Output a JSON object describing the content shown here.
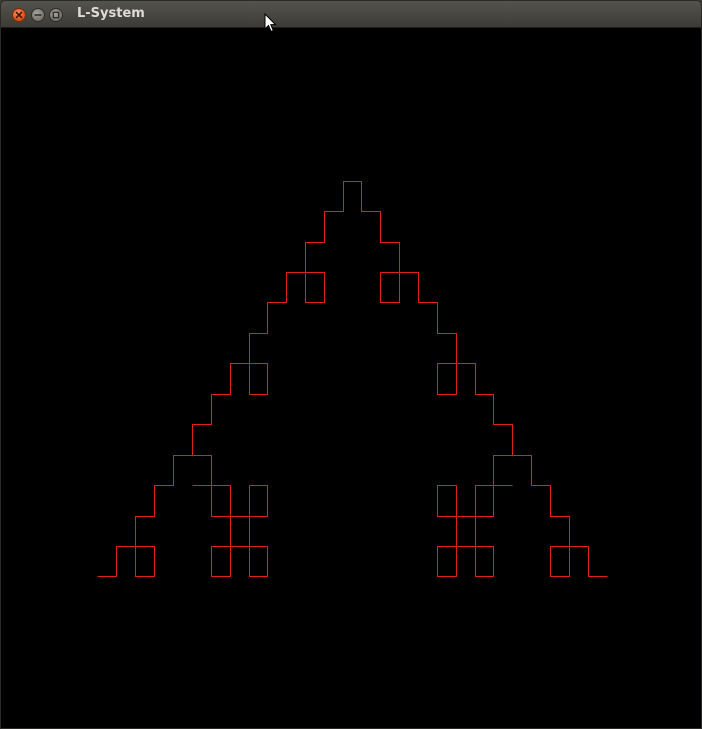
{
  "window": {
    "title": "L-System",
    "controls": {
      "close_icon": "close-icon",
      "minimize_icon": "minimize-icon",
      "maximize_icon": "maximize-icon"
    }
  },
  "canvas": {
    "background_color": "#000000",
    "stroke_color": "#e0201b",
    "content": "sierpinski-arrowhead-fractal"
  }
}
